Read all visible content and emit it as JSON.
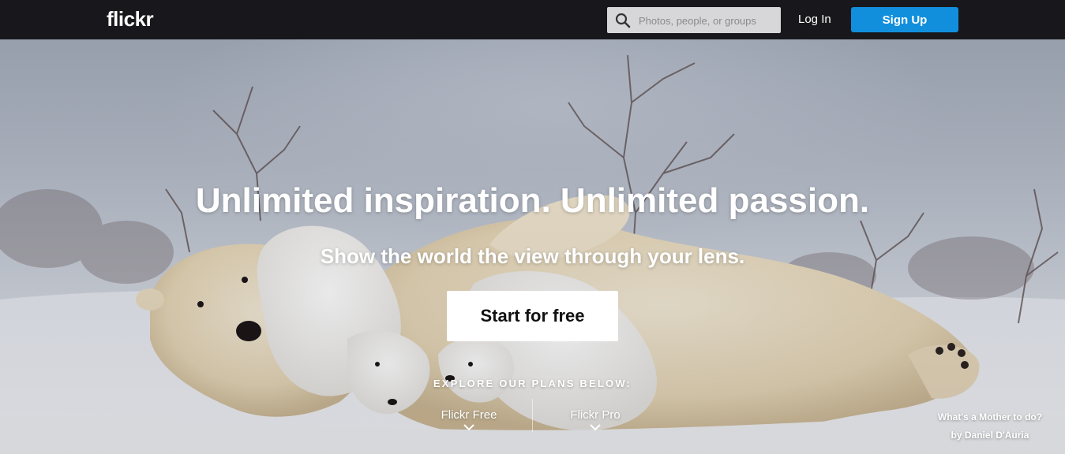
{
  "header": {
    "logo": "flickr",
    "search": {
      "placeholder": "Photos, people, or groups",
      "icon": "search-icon"
    },
    "login_label": "Log In",
    "signup_label": "Sign Up",
    "colors": {
      "bar": "#18181c",
      "signup": "#128fdc"
    }
  },
  "hero": {
    "headline": "Unlimited inspiration. Unlimited passion.",
    "subline": "Show the world the view through your lens.",
    "cta_label": "Start for free",
    "explore_label": "EXPLORE OUR PLANS BELOW:",
    "plans": [
      {
        "label": "Flickr Free",
        "icon": "chevron-down-icon"
      },
      {
        "label": "Flickr Pro",
        "icon": "chevron-down-icon"
      }
    ],
    "photo_credit": {
      "title": "What's a Mother to do?",
      "author": "by Daniel D'Auria"
    }
  }
}
